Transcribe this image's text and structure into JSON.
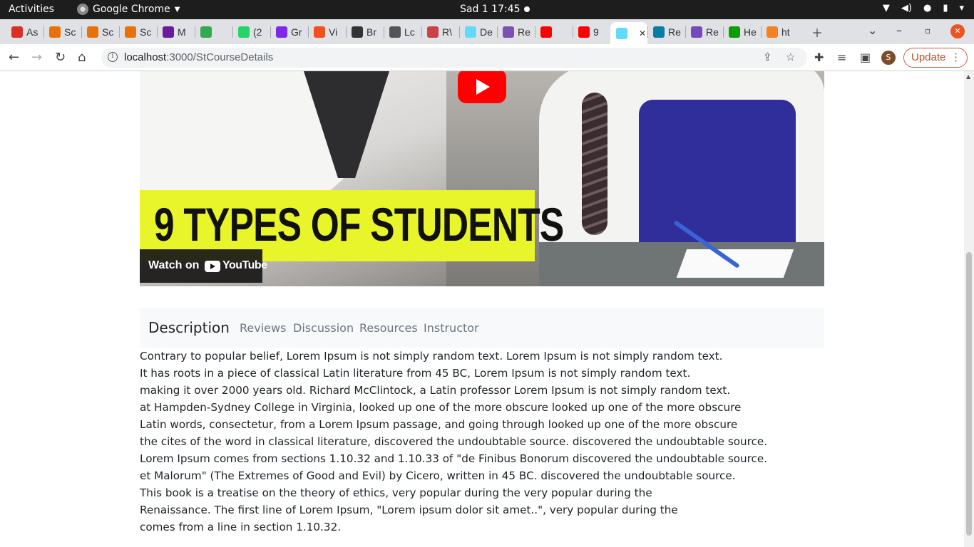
{
  "system_bar": {
    "activities": "Activities",
    "app_name": "Google Chrome",
    "clock": "Sad 1  17:45"
  },
  "browser": {
    "tabs": [
      {
        "label": "As",
        "icon": "gmail-icon",
        "color": "#d93025"
      },
      {
        "label": "Sc",
        "icon": "loading-icon",
        "color": "#e8710a"
      },
      {
        "label": "Sc",
        "icon": "loading-icon",
        "color": "#e8710a"
      },
      {
        "label": "Sc",
        "icon": "loading-icon",
        "color": "#e8710a"
      },
      {
        "label": "M",
        "icon": "app-icon",
        "color": "#6a1b9a"
      },
      {
        "label": "",
        "icon": "drive-icon",
        "color": "#34a853"
      },
      {
        "label": "(2",
        "icon": "whatsapp-icon",
        "color": "#25d366"
      },
      {
        "label": "Gr",
        "icon": "canva-icon",
        "color": "#7d2ae8"
      },
      {
        "label": "Vi",
        "icon": "figma-icon",
        "color": "#f24e1e"
      },
      {
        "label": "Br",
        "icon": "github-icon",
        "color": "#333333"
      },
      {
        "label": "Lc",
        "icon": "doc-icon",
        "color": "#555555"
      },
      {
        "label": "R\\",
        "icon": "react-router-icon",
        "color": "#ca4245"
      },
      {
        "label": "De",
        "icon": "react-icon",
        "color": "#61dafb"
      },
      {
        "label": "Re",
        "icon": "bootstrap-icon",
        "color": "#7952b3"
      },
      {
        "label": "",
        "icon": "youtube-icon",
        "color": "#ff0000"
      },
      {
        "label": "9",
        "icon": "youtube-icon",
        "color": "#ff0000"
      },
      {
        "label": "",
        "icon": "react-icon",
        "color": "#61dafb",
        "active": true
      },
      {
        "label": "Re",
        "icon": "react-icon",
        "color": "#087ea4"
      },
      {
        "label": "Re",
        "icon": "react-redux-icon",
        "color": "#764abc"
      },
      {
        "label": "He",
        "icon": "w-icon",
        "color": "#0a9e01"
      },
      {
        "label": "ht",
        "icon": "stackoverflow-icon",
        "color": "#f48024"
      }
    ],
    "url_host": "localhost",
    "url_path": ":3000/StCourseDetails",
    "update_label": "Update",
    "avatar_letter": "S"
  },
  "video": {
    "title": "9 TYPES OF STUDENTS",
    "watch_on": "Watch on",
    "youtube_word": "YouTube"
  },
  "course_tabs": [
    {
      "label": "Description",
      "active": true
    },
    {
      "label": "Reviews",
      "active": false
    },
    {
      "label": "Discussion",
      "active": false
    },
    {
      "label": "Resources",
      "active": false
    },
    {
      "label": "Instructor",
      "active": false
    }
  ],
  "description_lines": [
    "Contrary to popular belief, Lorem Ipsum is not simply random text. Lorem Ipsum is not simply random text.",
    "It has roots in a piece of classical Latin literature from 45 BC, Lorem Ipsum is not simply random text.",
    "making it over 2000 years old. Richard McClintock, a Latin professor Lorem Ipsum is not simply random text.",
    "at Hampden-Sydney College in Virginia, looked up one of the more obscure looked up one of the more obscure",
    "Latin words, consectetur, from a Lorem Ipsum passage, and going through looked up one of the more obscure",
    "the cites of the word in classical literature, discovered the undoubtable source. discovered the undoubtable source.",
    "Lorem Ipsum comes from sections 1.10.32 and 1.10.33 of \"de Finibus Bonorum discovered the undoubtable source.",
    "et Malorum\" (The Extremes of Good and Evil) by Cicero, written in 45 BC. discovered the undoubtable source.",
    "This book is a treatise on the theory of ethics, very popular during the very popular during the",
    "Renaissance. The first line of Lorem Ipsum, \"Lorem ipsum dolor sit amet..\", very popular during the",
    "comes from a line in section 1.10.32."
  ]
}
